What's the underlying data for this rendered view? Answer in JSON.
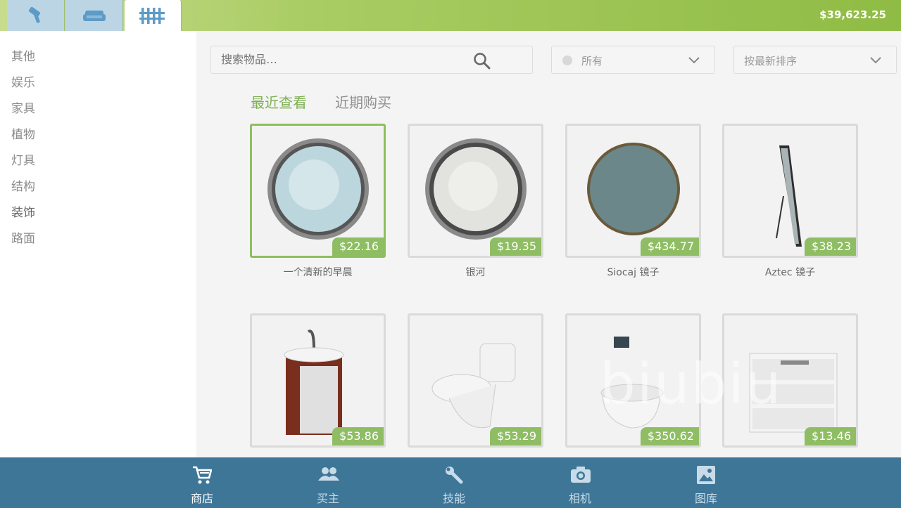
{
  "header": {
    "tabs": [
      {
        "icon": "hammer-icon"
      },
      {
        "icon": "sofa-icon"
      },
      {
        "icon": "fence-icon"
      }
    ],
    "money": "$39,623.25"
  },
  "sidebar": {
    "categories": [
      "其他",
      "娱乐",
      "家具",
      "植物",
      "灯具",
      "结构",
      "装饰",
      "路面"
    ]
  },
  "search": {
    "placeholder": "搜索物品…"
  },
  "filter": {
    "label": "所有"
  },
  "sort": {
    "label": "按最新排序"
  },
  "subtabs": [
    "最近查看",
    "近期购买"
  ],
  "items": [
    {
      "name": "一个清新的早晨",
      "price": "$22.16"
    },
    {
      "name": "银河",
      "price": "$19.35"
    },
    {
      "name": "Siocaj 镜子",
      "price": "$434.77"
    },
    {
      "name": "Aztec 镜子",
      "price": "$38.23"
    },
    {
      "name": "",
      "price": "$53.86"
    },
    {
      "name": "",
      "price": "$53.29"
    },
    {
      "name": "",
      "price": "$350.62"
    },
    {
      "name": "",
      "price": "$13.46"
    }
  ],
  "bottomnav": [
    {
      "label": "商店",
      "icon": "cart-icon"
    },
    {
      "label": "买主",
      "icon": "people-icon"
    },
    {
      "label": "技能",
      "icon": "wrench-icon"
    },
    {
      "label": "相机",
      "icon": "camera-icon"
    },
    {
      "label": "图库",
      "icon": "gallery-icon"
    }
  ],
  "watermark": "biubiu",
  "colors": {
    "accent_green": "#8fbd63",
    "nav_blue": "#3e7698"
  }
}
